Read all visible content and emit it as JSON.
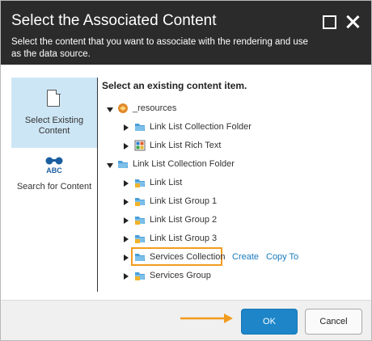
{
  "dialog": {
    "title": "Select the Associated Content",
    "subtitle": "Select the content that you want to associate with the rendering and use as the data source."
  },
  "sidebar": {
    "tabs": [
      {
        "label": "Select Existing Content",
        "icon": "document-icon",
        "active": true
      },
      {
        "label": "Search for Content",
        "icon": "binoculars-icon",
        "active": false
      }
    ]
  },
  "content": {
    "prompt": "Select an existing content item.",
    "tree": [
      {
        "label": "_resources",
        "expanded": true,
        "icon": "resources-icon"
      },
      {
        "label": "Link List Collection Folder",
        "expanded": false,
        "icon": "folder-icon"
      },
      {
        "label": "Link List Rich Text",
        "expanded": false,
        "icon": "grid-icon"
      },
      {
        "label": "Link List Collection Folder",
        "expanded": true,
        "icon": "folder-icon"
      },
      {
        "label": "Link List",
        "expanded": false,
        "icon": "lock-folder-icon"
      },
      {
        "label": "Link List Group 1",
        "expanded": false,
        "icon": "lock-folder-icon"
      },
      {
        "label": "Link List Group 2",
        "expanded": false,
        "icon": "lock-folder-icon"
      },
      {
        "label": "Link List Group 3",
        "expanded": false,
        "icon": "lock-folder-icon"
      },
      {
        "label": "Services Collection",
        "expanded": false,
        "icon": "folder-icon",
        "selected": true
      },
      {
        "label": "Services Group",
        "expanded": false,
        "icon": "lock-folder-icon"
      }
    ],
    "actions": {
      "create": "Create",
      "copy_to": "Copy To"
    }
  },
  "footer": {
    "ok_label": "OK",
    "cancel_label": "Cancel"
  },
  "colors": {
    "header": "#2b2b2b",
    "accent": "#1d85c8",
    "highlight": "#f29c1f",
    "active_tab": "#cde6f5"
  }
}
